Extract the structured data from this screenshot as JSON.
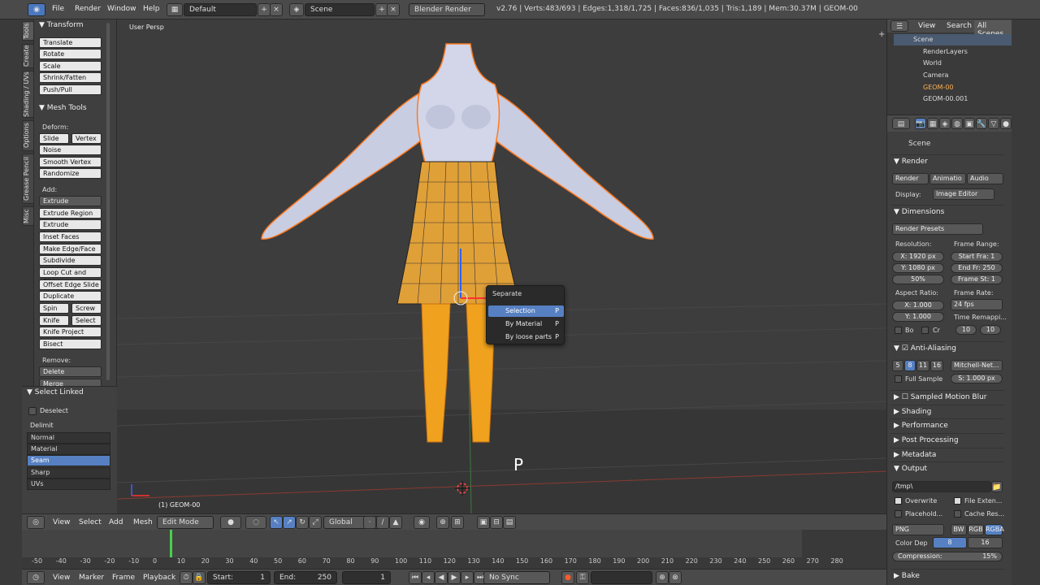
{
  "topbar": {
    "menus": [
      "File",
      "Render",
      "Window",
      "Help"
    ],
    "layout": "Default",
    "scene": "Scene",
    "engine": "Blender Render",
    "stats": "v2.76 | Verts:483/693 | Edges:1,318/1,725 | Faces:836/1,035 | Tris:1,189 | Mem:30.37M | GEOM-00"
  },
  "vtabs": [
    "Tools",
    "Create",
    "Shading / UVs",
    "Options",
    "Grease Pencil",
    "Misc"
  ],
  "tools": {
    "transform_header": "▼ Transform",
    "transform": [
      "Translate",
      "Rotate",
      "Scale",
      "Shrink/Fatten",
      "Push/Pull"
    ],
    "mesh_header": "▼ Mesh Tools",
    "deform_label": "Deform:",
    "slide_edge": "Slide Ed",
    "vertex": "Vertex",
    "deform": [
      "Noise",
      "Smooth Vertex",
      "Randomize"
    ],
    "add_label": "Add:",
    "extrude": "Extrude",
    "add": [
      "Extrude Region",
      "Extrude Individual",
      "Inset Faces",
      "Make Edge/Face",
      "Subdivide",
      "Loop Cut and Slide",
      "Offset Edge Slide",
      "Duplicate"
    ],
    "spin": "Spin",
    "screw": "Screw",
    "knife": "Knife",
    "select": "Select",
    "knife_project": "Knife Project",
    "bisect": "Bisect",
    "remove_label": "Remove:",
    "delete": "Delete",
    "merge": "Merge"
  },
  "select_linked": {
    "header": "▼ Select Linked",
    "deselect": "Deselect",
    "delimit": "Delimit",
    "options": [
      "Normal",
      "Material",
      "Seam",
      "Sharp",
      "UVs"
    ],
    "selected": "Seam"
  },
  "viewport": {
    "label": "User Persp",
    "object_label": "(1) GEOM-00",
    "key_hint": "P"
  },
  "separate_menu": {
    "title": "Separate",
    "items": [
      {
        "label": "Selection",
        "key": "P"
      },
      {
        "label": "By Material",
        "key": "P"
      },
      {
        "label": "By loose parts",
        "key": "P"
      }
    ]
  },
  "viewport_header": {
    "menus": [
      "View",
      "Select",
      "Add",
      "Mesh"
    ],
    "mode": "Edit Mode",
    "orientation": "Global"
  },
  "timeline": {
    "ticks": [
      "-50",
      "-40",
      "-30",
      "-20",
      "-10",
      "0",
      "10",
      "20",
      "30",
      "40",
      "50",
      "60",
      "70",
      "80",
      "90",
      "100",
      "110",
      "120",
      "130",
      "140",
      "150",
      "160",
      "170",
      "180",
      "190",
      "200",
      "210",
      "220",
      "230",
      "240",
      "250",
      "260",
      "270",
      "280"
    ],
    "menus": [
      "View",
      "Marker",
      "Frame",
      "Playback"
    ],
    "start_label": "Start:",
    "start": "1",
    "end_label": "End:",
    "end": "250",
    "current": "1",
    "sync": "No Sync"
  },
  "outliner": {
    "menus": [
      "View",
      "Search",
      "All Scenes"
    ],
    "items": [
      "Scene",
      "RenderLayers",
      "World",
      "Camera",
      "GEOM-00",
      "GEOM-00.001"
    ]
  },
  "properties": {
    "scene": "Scene",
    "render_header": "Render",
    "render_btn": "Render",
    "animation_btn": "Animatio",
    "audio_btn": "Audio",
    "display_label": "Display:",
    "display_value": "Image Editor",
    "dimensions_header": "Dimensions",
    "presets": "Render Presets",
    "resolution_label": "Resolution:",
    "res_x": "X: 1920 px",
    "res_y": "Y: 1080 px",
    "res_pct": "50%",
    "frame_range_label": "Frame Range:",
    "start_fra": "Start Fra: 1",
    "end_fr": "End Fr: 250",
    "frame_st": "Frame St: 1",
    "aspect_label": "Aspect Ratio:",
    "asp_x": "X:    1.000",
    "asp_y": "Y:    1.000",
    "frame_rate_label": "Frame Rate:",
    "fps": "24 fps",
    "time_remap": "Time Remappi...",
    "remap_a": "10",
    "remap_b": "10",
    "bo": "Bo",
    "cr": "Cr",
    "aa_header": "Anti-Aliasing",
    "aa_samples": [
      "5",
      "8",
      "11",
      "16"
    ],
    "aa_selected": "8",
    "filter": "Mitchell-Net...",
    "full_sample": "Full Sample",
    "filter_size": "S: 1.000 px",
    "motion_blur": "Sampled Motion Blur",
    "collapsed": [
      "Shading",
      "Performance",
      "Post Processing",
      "Metadata"
    ],
    "output_header": "Output",
    "output_path": "/tmp\\",
    "overwrite": "Overwrite",
    "file_ext": "File Exten...",
    "placeholders": "Placehold...",
    "cache_result": "Cache Res...",
    "format": "PNG",
    "color_modes": [
      "BW",
      "RGB",
      "RGBA"
    ],
    "color_depth_label": "Color Dep",
    "depth_8": "8",
    "depth_16": "16",
    "compression": "Compression:",
    "compression_value": "15%",
    "bake_header": "Bake"
  }
}
